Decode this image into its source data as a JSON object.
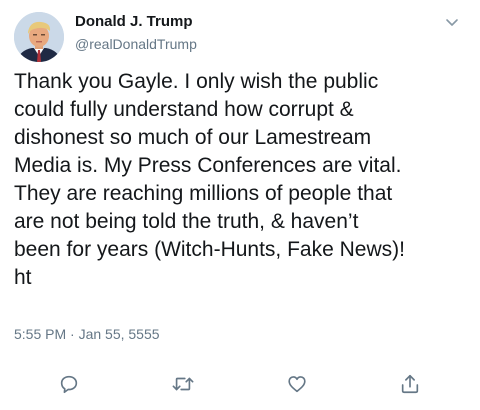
{
  "header": {
    "display_name": "Donald J. Trump",
    "handle": "@realDonaldTrump"
  },
  "tweet": {
    "lines": [
      "Thank you Gayle. I only wish the public",
      "could fully understand how corrupt &",
      "dishonest so much of our Lamestream",
      "Media is. My Press Conferences are vital.",
      "They are reaching millions of people that",
      "are not being told the truth, & haven’t",
      "been for years (Witch-Hunts, Fake News)!",
      "ht"
    ],
    "timestamp": "5:55 PM · Jan 55, 5555"
  },
  "icons": {
    "menu": "chevron-down-icon",
    "reply": "reply-icon",
    "retweet": "retweet-icon",
    "like": "heart-icon",
    "share": "share-icon"
  },
  "colors": {
    "text_primary": "#14171a",
    "text_secondary": "#657786",
    "icon": "#657786"
  }
}
